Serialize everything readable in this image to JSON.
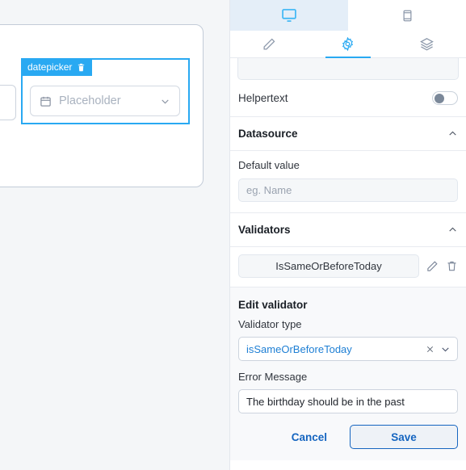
{
  "canvas": {
    "widget": {
      "tag_label": "datepicker",
      "delete_icon": "trash-icon",
      "calendar_icon": "calendar-icon",
      "placeholder": "Placeholder",
      "chevron_icon": "chevron-down-icon"
    }
  },
  "panel": {
    "device_tabs": [
      {
        "name": "desktop",
        "icon": "monitor-icon",
        "active": true
      },
      {
        "name": "mobile",
        "icon": "phone-icon",
        "active": false
      }
    ],
    "icon_tabs": [
      {
        "name": "styles",
        "icon": "pencil-icon",
        "active": false
      },
      {
        "name": "settings",
        "icon": "gear-icon",
        "active": true
      },
      {
        "name": "layers",
        "icon": "layers-icon",
        "active": false
      }
    ],
    "helpertext": {
      "label": "Helpertext",
      "enabled": false
    },
    "datasource": {
      "title": "Datasource",
      "collapse_icon": "chevron-up-icon",
      "default_value": {
        "label": "Default value",
        "placeholder": "eg. Name",
        "value": ""
      }
    },
    "validators": {
      "title": "Validators",
      "collapse_icon": "chevron-up-icon",
      "items": [
        {
          "label": "IsSameOrBeforeToday",
          "edit_icon": "pencil-icon",
          "delete_icon": "trash-icon"
        }
      ]
    },
    "edit_validator": {
      "title": "Edit validator",
      "type_label": "Validator type",
      "type_value": "isSameOrBeforeToday",
      "clear_icon": "close-icon",
      "dropdown_icon": "chevron-down-icon",
      "error_label": "Error Message",
      "error_value": "The birthday should be in the past",
      "cancel_label": "Cancel",
      "save_label": "Save"
    }
  },
  "colors": {
    "accent_blue": "#29a9f2",
    "link_blue": "#1565c0",
    "select_text": "#1e7fd4",
    "active_tab_bg": "#e4eef8",
    "canvas_bg": "#f4f6f8",
    "panel_bg": "#ffffff",
    "input_bg": "#f5f7f9"
  }
}
